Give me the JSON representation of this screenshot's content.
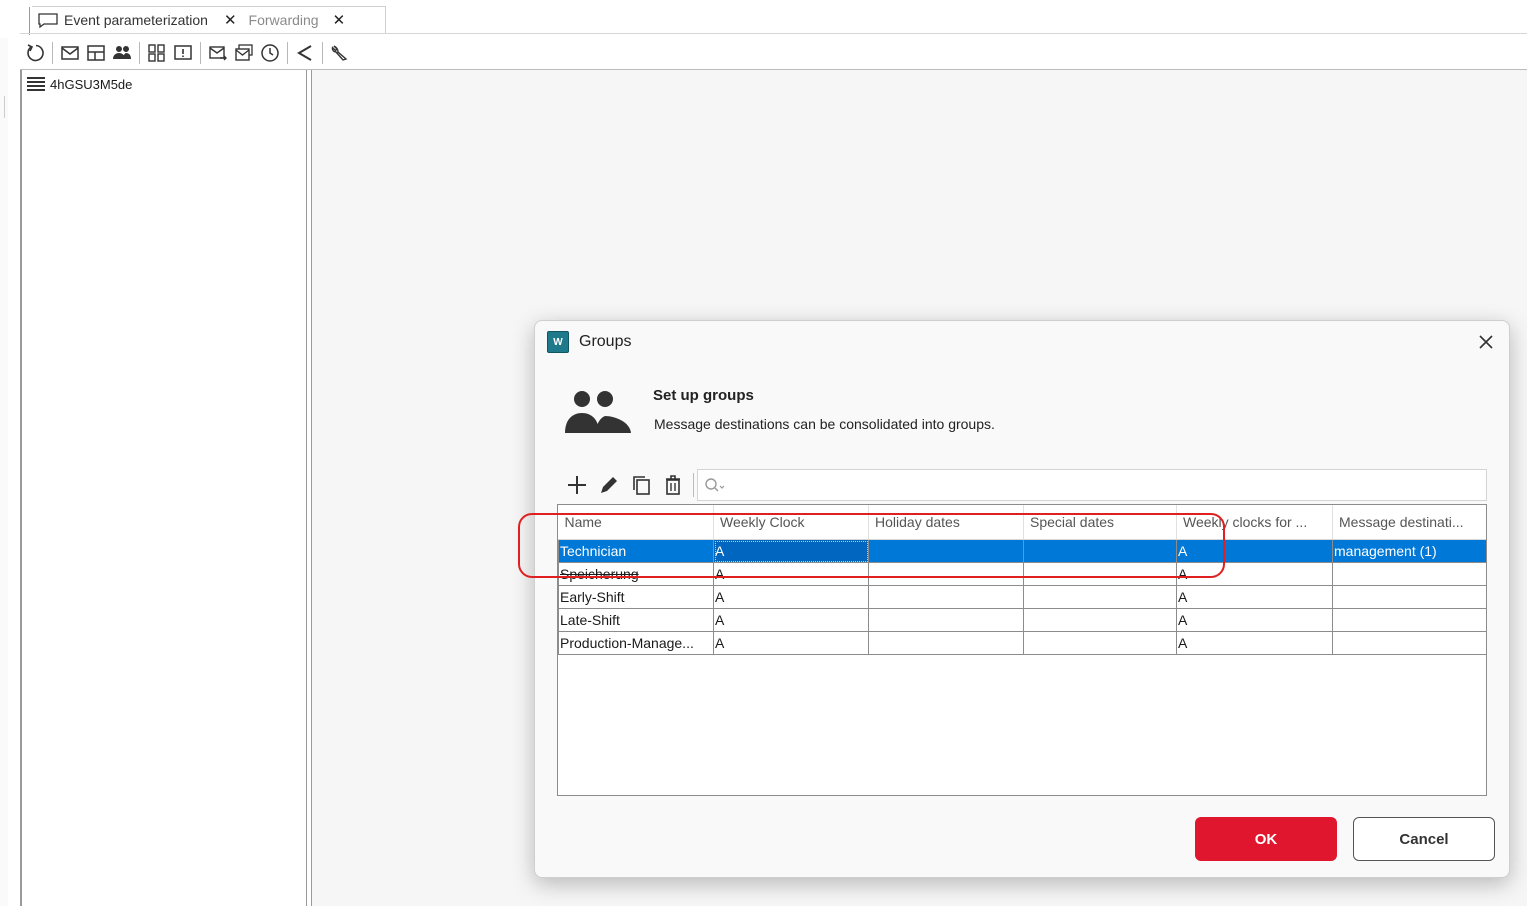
{
  "tabs": [
    {
      "label": "Event parameterization",
      "icon": "chat-bubble-icon",
      "active": true
    },
    {
      "label": "Forwarding",
      "active": false
    }
  ],
  "toolbar": {
    "icons": [
      "refresh-icon",
      "mail-icon",
      "layout-icon",
      "group-icon",
      "grid-icon",
      "message-icon",
      "mail-forward-icon",
      "mail-multi-icon",
      "clock-icon",
      "share-icon",
      "wrench-icon"
    ]
  },
  "tree": {
    "root_label": "4hGSU3M5de",
    "root_icon": "list-icon"
  },
  "dialog": {
    "title": "Groups",
    "app_icon_label": "W",
    "header_title": "Set up groups",
    "header_subtitle": "Message destinations can be consolidated into groups.",
    "header_icon": "users-icon",
    "search_placeholder": "",
    "columns": [
      "Name",
      "Weekly Clock",
      "Holiday dates",
      "Special dates",
      "Weekly clocks for ...",
      "Message destinati..."
    ],
    "rows": [
      [
        "Technician",
        "A",
        "",
        "",
        "A",
        "management (1)"
      ],
      [
        "Speicherung",
        "A",
        "",
        "",
        "A",
        ""
      ],
      [
        "Early-Shift",
        "A",
        "",
        "",
        "A",
        ""
      ],
      [
        "Late-Shift",
        "A",
        "",
        "",
        "A",
        ""
      ],
      [
        "Production-Manage...",
        "A",
        "",
        "",
        "A",
        ""
      ]
    ],
    "selected_row": 0,
    "ok_label": "OK",
    "cancel_label": "Cancel",
    "accent_color": "#e0162e",
    "selection_color": "#0078d7",
    "annotation_color": "#e02020"
  }
}
